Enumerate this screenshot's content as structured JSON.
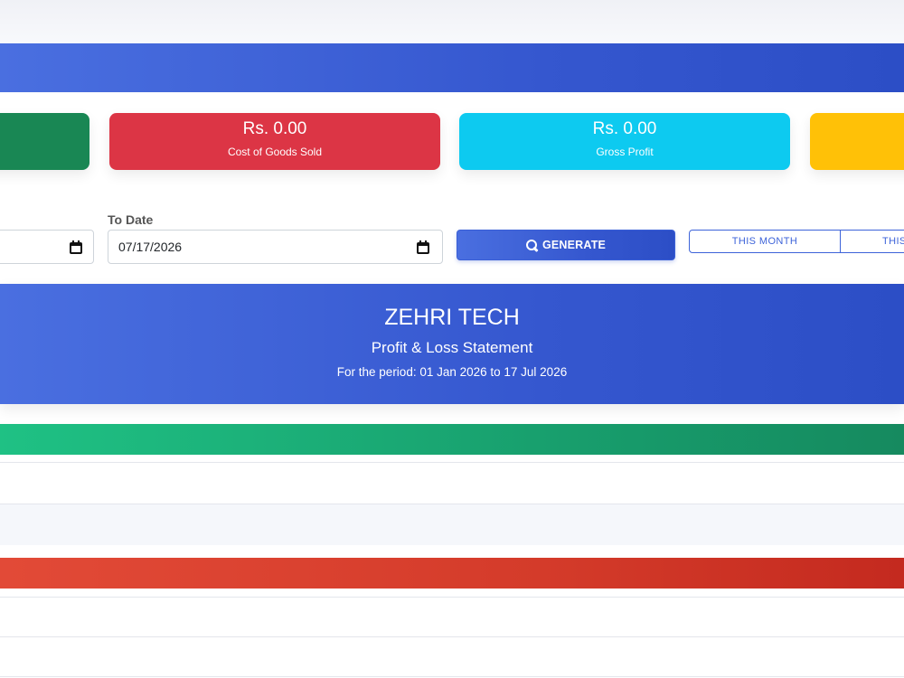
{
  "summary_cards": {
    "cogs": {
      "amount": "Rs. 0.00",
      "label": "Cost of Goods Sold",
      "color": "#dc3545"
    },
    "gross_profit": {
      "amount": "Rs. 0.00",
      "label": "Gross Profit",
      "color": "#0dcaf0"
    },
    "left_card_color": "#198754",
    "right_card_color": "#ffc107"
  },
  "filters": {
    "to_date_label": "To Date",
    "to_date_value": "07/17/2026",
    "generate_label": "GENERATE",
    "quick_this_month": "THIS MONTH",
    "quick_next": "THIS"
  },
  "statement": {
    "company": "ZEHRI TECH",
    "title": "Profit & Loss Statement",
    "period": "For the period: 01 Jan 2026 to 17 Jul 2026"
  },
  "colors": {
    "primary": "#3557cf",
    "income_bar": "#179a6a",
    "expense_bar": "#d43b2a"
  }
}
